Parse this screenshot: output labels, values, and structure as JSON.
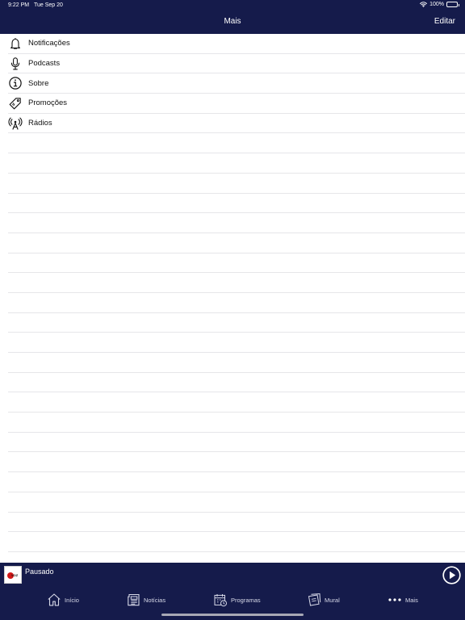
{
  "status_bar": {
    "time": "9:22 PM",
    "date": "Tue Sep 20",
    "battery_percent": "100%",
    "battery_level": 1.0
  },
  "navigation": {
    "title": "Mais",
    "edit_label": "Editar"
  },
  "menu": {
    "items": [
      {
        "label": "Notificações",
        "icon": "bell-icon"
      },
      {
        "label": "Podcasts",
        "icon": "microphone-icon"
      },
      {
        "label": "Sobre",
        "icon": "info-icon"
      },
      {
        "label": "Promoções",
        "icon": "tag-icon"
      },
      {
        "label": "Rádios",
        "icon": "radio-tower-icon"
      }
    ]
  },
  "player": {
    "status": "Pausado",
    "icon": "play-icon"
  },
  "tab_bar": {
    "items": [
      {
        "label": "Início",
        "icon": "home-icon"
      },
      {
        "label": "Notícias",
        "icon": "newspaper-icon"
      },
      {
        "label": "Programas",
        "icon": "calendar-clock-icon"
      },
      {
        "label": "Mural",
        "icon": "notes-icon"
      },
      {
        "label": "Mais",
        "icon": "more-dots-icon"
      }
    ]
  },
  "colors": {
    "header_background": "#151b4b",
    "row_separator": "#e6e6e9",
    "text_primary": "#111111",
    "tab_text": "#d7d9e8"
  }
}
